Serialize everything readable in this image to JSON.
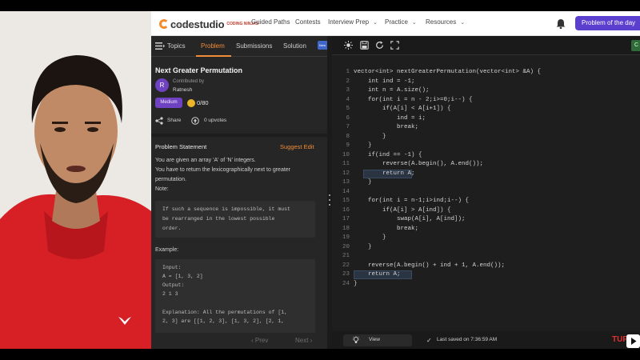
{
  "nav": {
    "logo_text": "codestudio",
    "logo_sub": "POWERED BY",
    "logo_badge": "CODING NINJAS",
    "items": [
      "Guided Paths",
      "Contests",
      "Interview Prep",
      "Practice",
      "Resources"
    ],
    "potd_label": "Problem of the day"
  },
  "tabs": {
    "topics": "Topics",
    "problem": "Problem",
    "submissions": "Submissions",
    "solution": "Solution",
    "new_badge": "New"
  },
  "problem": {
    "title": "Next Greater Permutation",
    "avatar_letter": "R",
    "contributed_by": "Contributed by",
    "contributor": "Ratnesh",
    "difficulty": "Medium",
    "score": "0/80",
    "share": "Share",
    "upvotes": "0 upvotes",
    "statement_heading": "Problem Statement",
    "suggest_edit": "Suggest Edit",
    "statement_lines": [
      "You are given an array 'A' of 'N' integers.",
      "You have to return the lexicographically next to greater",
      "permutation.",
      "Note:"
    ],
    "note_lines": [
      "If such a sequence is impossible, it must",
      "be rearranged in the lowest possible",
      "order."
    ],
    "example_label": "Example:",
    "example_lines": [
      "Input:",
      "A = [1, 3, 2]",
      "Output:",
      "2 1 3",
      "",
      "Explanation: All the permutations of [1,",
      "2, 3] are [[1, 2, 3], [1, 3, 2], [2, 1,"
    ],
    "prev": "‹ Prev",
    "next": "Next ›"
  },
  "editor": {
    "lang": "C",
    "line_numbers": [
      "1",
      "2",
      "3",
      "4",
      "5",
      "6",
      "7",
      "8",
      "9",
      "10",
      "11",
      "12",
      "13",
      "14",
      "15",
      "16",
      "17",
      "18",
      "19",
      "20",
      "21",
      "22",
      "23",
      "24"
    ],
    "lines": [
      "vector<int> nextGreaterPermutation(vector<int> &A) {",
      "    int ind = -1;",
      "    int n = A.size();",
      "    for(int i = n - 2;i>=0;i--) {",
      "        if(A[i] < A[i+1]) {",
      "            ind = i;",
      "            break;",
      "        }",
      "    }",
      "    if(ind == -1) {",
      "        reverse(A.begin(), A.end());",
      "        return A;",
      "    }",
      "",
      "    for(int i = n-1;i>ind;i--) {",
      "        if(A[i] > A[ind]) {",
      "            swap(A[i], A[ind]);",
      "            break;",
      "        }",
      "    }",
      "",
      "    reverse(A.begin() + ind + 1, A.end());",
      "    return A;",
      "}"
    ],
    "view_label": "View",
    "saved_label": "Last saved on 7:36:59 AM"
  },
  "watermark": "TUF",
  "colors": {
    "accent": "#f28c38",
    "potd": "#5b3fcf",
    "medium": "#6f42c1"
  }
}
